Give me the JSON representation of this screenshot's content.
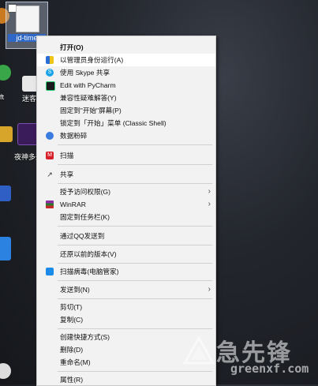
{
  "desktop": {
    "selected_file_label": "jd-time",
    "items": [
      {
        "label": "ft"
      },
      {
        "label": "迷客"
      },
      {
        "label": "夜神多开"
      }
    ]
  },
  "menu": {
    "items": [
      {
        "label": "打开(O)",
        "icon": "none",
        "bold": true
      },
      {
        "label": "以管理员身份运行(A)",
        "icon": "shield-icon",
        "highlight": true
      },
      {
        "label": "使用 Skype 共享",
        "icon": "skype-icon"
      },
      {
        "label": "Edit with PyCharm",
        "icon": "pycharm-icon"
      },
      {
        "label": "兼容性疑难解答(Y)",
        "icon": "none"
      },
      {
        "label": "固定到\"开始\"屏幕(P)",
        "icon": "none"
      },
      {
        "label": "锁定到「开始」菜单 (Classic Shell)",
        "icon": "none"
      },
      {
        "label": "数据粉碎",
        "icon": "shred-icon"
      },
      {
        "label": "扫描",
        "icon": "mcafee-icon"
      },
      {
        "label": "共享",
        "icon": "share-icon"
      },
      {
        "label": "授予访问权限(G)",
        "icon": "none",
        "submenu": true
      },
      {
        "label": "WinRAR",
        "icon": "winrar-icon",
        "submenu": true
      },
      {
        "label": "固定到任务栏(K)",
        "icon": "none"
      },
      {
        "label": "通过QQ发送到",
        "icon": "none"
      },
      {
        "label": "还原以前的版本(V)",
        "icon": "none"
      },
      {
        "label": "扫描病毒(电脑管家)",
        "icon": "tencent-guard-icon"
      },
      {
        "label": "发送到(N)",
        "icon": "none",
        "submenu": true
      },
      {
        "label": "剪切(T)",
        "icon": "none"
      },
      {
        "label": "复制(C)",
        "icon": "none"
      },
      {
        "label": "创建快捷方式(S)",
        "icon": "none"
      },
      {
        "label": "删除(D)",
        "icon": "none"
      },
      {
        "label": "重命名(M)",
        "icon": "none"
      },
      {
        "label": "属性(R)",
        "icon": "none"
      }
    ]
  },
  "watermark": {
    "text": "急先锋",
    "url": "greenxf.com"
  }
}
